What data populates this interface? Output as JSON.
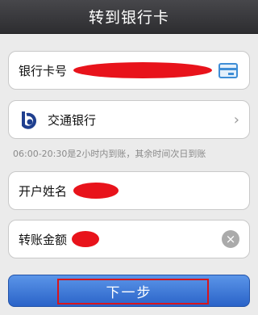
{
  "header": {
    "title": "转到银行卡"
  },
  "card_field": {
    "label": "银行卡号",
    "icon": "card-icon"
  },
  "bank_field": {
    "bank_name": "交通银行",
    "icon": "bank-logo-icon"
  },
  "hint": "06:00-20:30是2小时内到账，其余时间次日到账",
  "name_field": {
    "label": "开户姓名"
  },
  "amount_field": {
    "label": "转账金额",
    "clear_icon": "×"
  },
  "next_button": {
    "label": "下一步"
  },
  "colors": {
    "primary": "#2f6fd6",
    "redaction": "#e8131b",
    "highlight": "#d8141b"
  }
}
